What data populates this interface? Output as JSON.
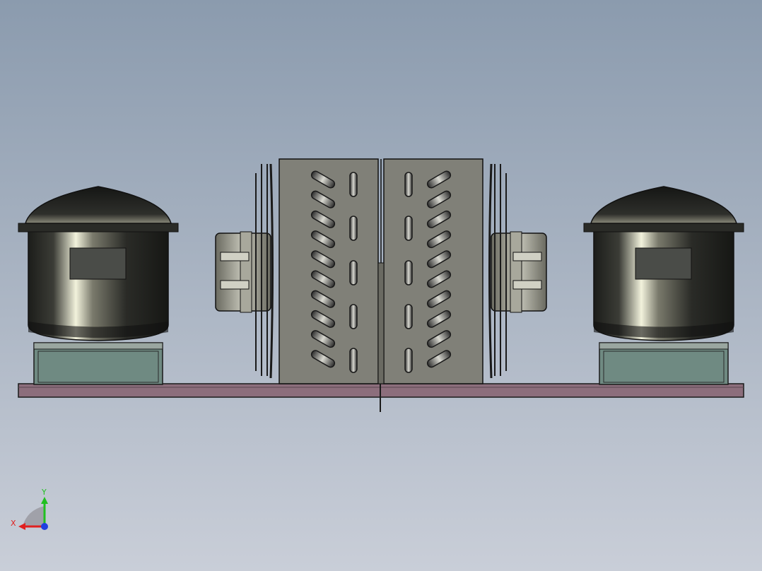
{
  "viewport": {
    "background_top": "#8b9bae",
    "background_bottom": "#c9ced8"
  },
  "triad": {
    "x_label": "X",
    "y_label": "Y",
    "x_color": "#e02020",
    "y_color": "#20c020",
    "z_color": "#2040e0"
  },
  "colors": {
    "motor_body": "#2a2b28",
    "motor_highlight": "#f2f2dc",
    "motor_nameplate": "#4a4c48",
    "motor_base": "#6f8a82",
    "coil_plate": "#808078",
    "coil_slot": "#3a3a3a",
    "baseplate": "#8c6e7c",
    "edge": "#1a1a1a"
  }
}
